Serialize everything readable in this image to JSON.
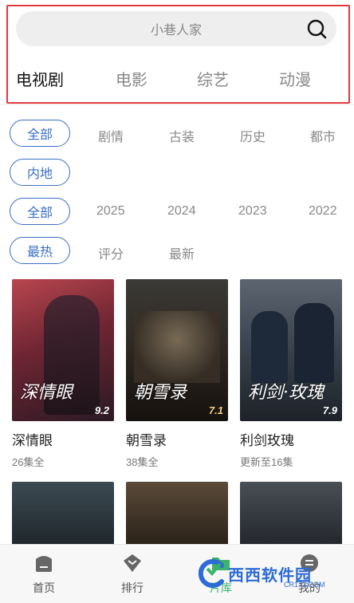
{
  "search": {
    "placeholder": "小巷人家"
  },
  "top_tabs": [
    {
      "label": "电视剧",
      "active": true
    },
    {
      "label": "电影",
      "active": false
    },
    {
      "label": "综艺",
      "active": false
    },
    {
      "label": "动漫",
      "active": false
    }
  ],
  "filters": {
    "genre": {
      "selected": "全部",
      "options": [
        "剧情",
        "古装",
        "历史",
        "都市"
      ]
    },
    "region": {
      "selected": "内地"
    },
    "year": {
      "selected": "全部",
      "options": [
        "2025",
        "2024",
        "2023",
        "2022"
      ]
    },
    "sort": {
      "selected": "最热",
      "options": [
        "评分",
        "最新"
      ]
    }
  },
  "shows": [
    {
      "title": "深情眼",
      "subtitle": "26集全",
      "rating": "9.2",
      "poster_text": "深情眼"
    },
    {
      "title": "朝雪录",
      "subtitle": "38集全",
      "rating": "7.1",
      "poster_text": "朝雪录"
    },
    {
      "title": "利剑玫瑰",
      "subtitle": "更新至16集",
      "rating": "7.9",
      "poster_text": "利剑·玫瑰"
    }
  ],
  "bottom_nav": [
    {
      "label": "首页",
      "icon": "home-icon"
    },
    {
      "label": "排行",
      "icon": "rank-icon"
    },
    {
      "label": "片库",
      "icon": "library-icon"
    },
    {
      "label": "我的",
      "icon": "profile-icon"
    }
  ],
  "watermark": {
    "text": "西西软件园",
    "sub": "CR173.COM"
  },
  "colors": {
    "accent": "#3a6fc4",
    "highlight": "#e0393e"
  }
}
